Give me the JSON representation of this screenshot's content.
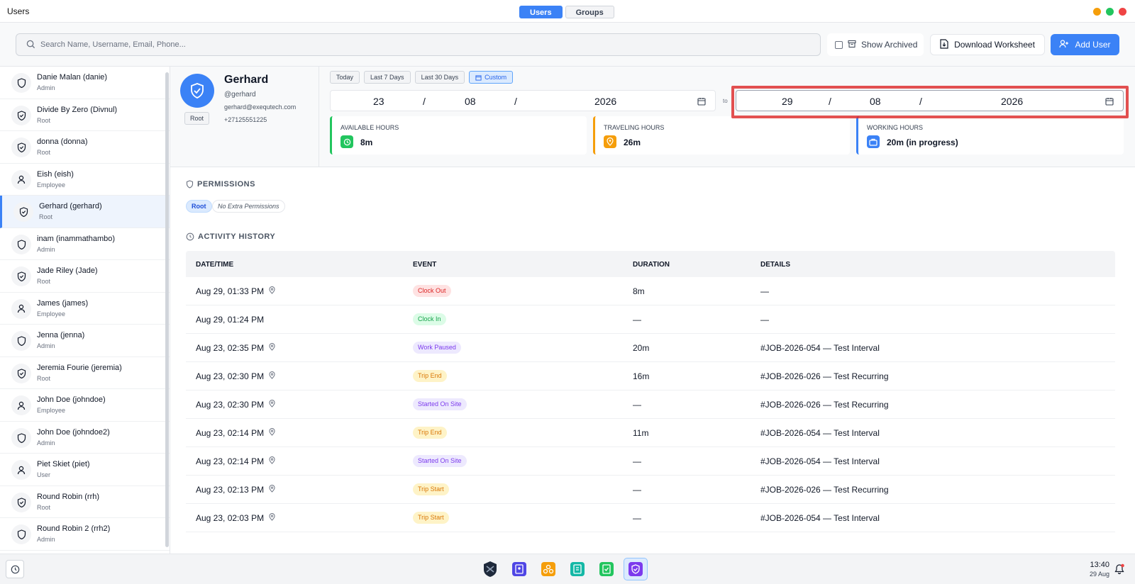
{
  "window": {
    "title": "Users"
  },
  "tabs": [
    {
      "label": "Users"
    },
    {
      "label": "Groups"
    }
  ],
  "colors": {
    "accent": "#3b82f6",
    "close": "#ef4444",
    "minimize": "#f59e0b",
    "maximize": "#22c55e",
    "highlight": "#dc2626"
  },
  "toolbar": {
    "search_placeholder": "Search Name, Username, Email, Phone...",
    "show_archived": "Show Archived",
    "download": "Download Worksheet",
    "add_user": "Add User"
  },
  "users": [
    {
      "name": "Danie Malan (danie)",
      "role": "Admin",
      "icon": "shield-icon"
    },
    {
      "name": "Divide By Zero (Divnul)",
      "role": "Root",
      "icon": "shield-check-icon"
    },
    {
      "name": "donna (donna)",
      "role": "Root",
      "icon": "shield-check-icon"
    },
    {
      "name": "Eish (eish)",
      "role": "Employee",
      "icon": "person-icon"
    },
    {
      "name": "Gerhard (gerhard)",
      "role": "Root",
      "icon": "shield-check-icon"
    },
    {
      "name": "inam (inammathambo)",
      "role": "Admin",
      "icon": "shield-icon"
    },
    {
      "name": "Jade Riley (Jade)",
      "role": "Root",
      "icon": "shield-check-icon"
    },
    {
      "name": "James (james)",
      "role": "Employee",
      "icon": "person-icon"
    },
    {
      "name": "Jenna (jenna)",
      "role": "Admin",
      "icon": "shield-icon"
    },
    {
      "name": "Jeremia Fourie (jeremia)",
      "role": "Root",
      "icon": "shield-check-icon"
    },
    {
      "name": "John Doe (johndoe)",
      "role": "Employee",
      "icon": "person-icon"
    },
    {
      "name": "John Doe (johndoe2)",
      "role": "Admin",
      "icon": "shield-icon"
    },
    {
      "name": "Piet Skiet (piet)",
      "role": "User",
      "icon": "person-icon"
    },
    {
      "name": "Round Robin (rrh)",
      "role": "Root",
      "icon": "shield-check-icon"
    },
    {
      "name": "Round Robin 2 (rrh2)",
      "role": "Admin",
      "icon": "shield-icon"
    }
  ],
  "profile": {
    "name": "Gerhard",
    "username": "@gerhard",
    "email": "gerhard@exequtech.com",
    "phone": "+27125551225",
    "role": "Root"
  },
  "ranges": [
    {
      "label": "Today"
    },
    {
      "label": "Last 7 Days"
    },
    {
      "label": "Last 30 Days"
    },
    {
      "label": "Custom"
    }
  ],
  "date_from": {
    "day": "23",
    "month": "08",
    "year": "2026",
    "sep": "/"
  },
  "to_label": "to",
  "date_to": {
    "day": "29",
    "month": "08",
    "year": "2026",
    "sep": "/"
  },
  "stats": [
    {
      "label": "AVAILABLE HOURS",
      "value": "8m",
      "color": "#22c55e",
      "icon": "clock-icon"
    },
    {
      "label": "TRAVELING HOURS",
      "value": "26m",
      "color": "#f59e0b",
      "icon": "location-pin-icon"
    },
    {
      "label": "WORKING HOURS",
      "value": "20m (in progress)",
      "color": "#3b82f6",
      "icon": "briefcase-icon"
    }
  ],
  "permissions": {
    "title": "PERMISSIONS",
    "role": "Root",
    "extra": "No Extra Permissions"
  },
  "activity": {
    "title": "ACTIVITY HISTORY",
    "columns": [
      "DATE/TIME",
      "EVENT",
      "DURATION",
      "DETAILS"
    ],
    "rows": [
      {
        "datetime": "Aug 29, 01:33 PM",
        "pin": true,
        "event": "Clock Out",
        "kind": "red",
        "duration": "8m",
        "details": "—"
      },
      {
        "datetime": "Aug 29, 01:24 PM",
        "pin": false,
        "event": "Clock In",
        "kind": "green",
        "duration": "—",
        "details": "—"
      },
      {
        "datetime": "Aug 23, 02:35 PM",
        "pin": true,
        "event": "Work Paused",
        "kind": "purple",
        "duration": "20m",
        "details": "#JOB-2026-054 — Test Interval"
      },
      {
        "datetime": "Aug 23, 02:30 PM",
        "pin": true,
        "event": "Trip End",
        "kind": "orange",
        "duration": "16m",
        "details": "#JOB-2026-026 — Test Recurring"
      },
      {
        "datetime": "Aug 23, 02:30 PM",
        "pin": true,
        "event": "Started On Site",
        "kind": "purple",
        "duration": "—",
        "details": "#JOB-2026-026 — Test Recurring"
      },
      {
        "datetime": "Aug 23, 02:14 PM",
        "pin": true,
        "event": "Trip End",
        "kind": "orange",
        "duration": "11m",
        "details": "#JOB-2026-054 — Test Interval"
      },
      {
        "datetime": "Aug 23, 02:14 PM",
        "pin": true,
        "event": "Started On Site",
        "kind": "purple",
        "duration": "—",
        "details": "#JOB-2026-054 — Test Interval"
      },
      {
        "datetime": "Aug 23, 02:13 PM",
        "pin": true,
        "event": "Trip Start",
        "kind": "orange",
        "duration": "—",
        "details": "#JOB-2026-026 — Test Recurring"
      },
      {
        "datetime": "Aug 23, 02:03 PM",
        "pin": true,
        "event": "Trip Start",
        "kind": "orange",
        "duration": "—",
        "details": "#JOB-2026-054 — Test Interval"
      }
    ]
  },
  "taskbar": {
    "time": "13:40",
    "date": "29 Aug"
  }
}
